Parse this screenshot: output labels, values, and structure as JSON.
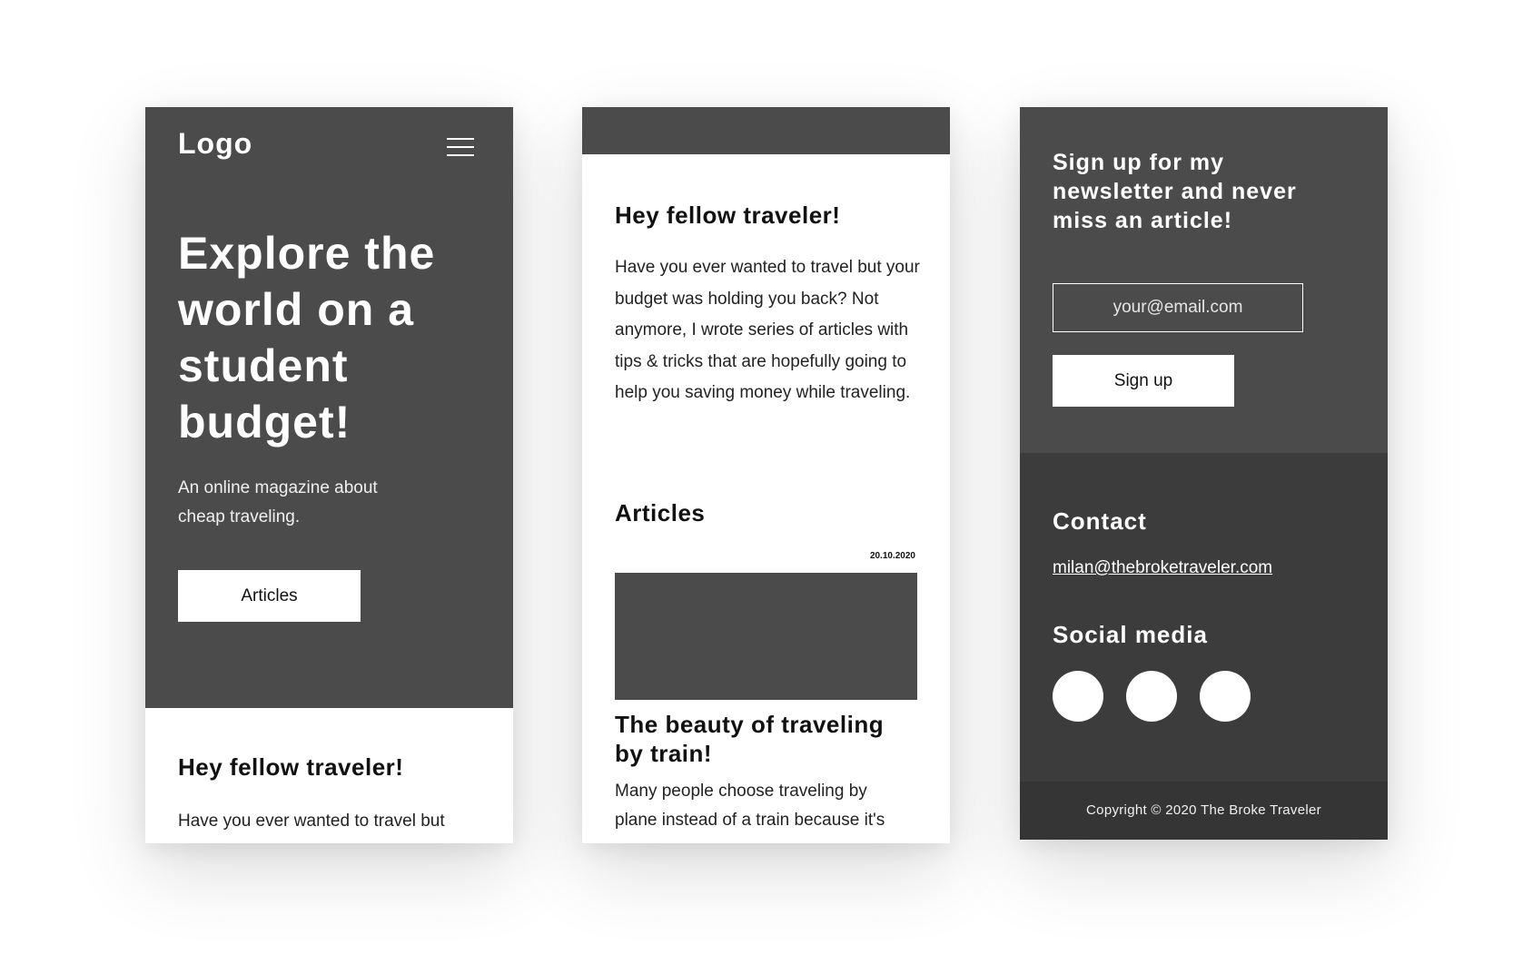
{
  "screen1": {
    "logo": "Logo",
    "hero_title": "Explore the world on a student budget!",
    "hero_subtitle": "An online magazine about cheap traveling.",
    "hero_button": "Articles",
    "intro_title": "Hey fellow traveler!",
    "intro_text": "Have you ever wanted to travel but"
  },
  "screen2": {
    "intro_title": "Hey fellow traveler!",
    "intro_text": "Have you ever wanted to travel but your budget was holding you back? Not anymore, I wrote series of articles with tips & tricks that are hopefully going to help you saving money while traveling.",
    "articles_title": "Articles",
    "article": {
      "date": "20.10.2020",
      "title": "The beauty of traveling by train!",
      "excerpt": "Many people choose traveling by\nplane instead of a train because it's"
    }
  },
  "screen3": {
    "newsletter_title": "Sign up for my newsletter and never miss an article!",
    "email_placeholder": "your@email.com",
    "signup_button": "Sign up",
    "contact_title": "Contact",
    "contact_email": "milan@thebroketraveler.com",
    "social_title": "Social media",
    "social_icons": [
      "social-icon-1",
      "social-icon-2",
      "social-icon-3"
    ],
    "copyright": "Copyright © 2020 The Broke Traveler"
  },
  "colors": {
    "dark_gray": "#4b4b4b",
    "footer_gray": "#3c3c3c",
    "copyright_gray": "#353535",
    "white": "#ffffff"
  }
}
